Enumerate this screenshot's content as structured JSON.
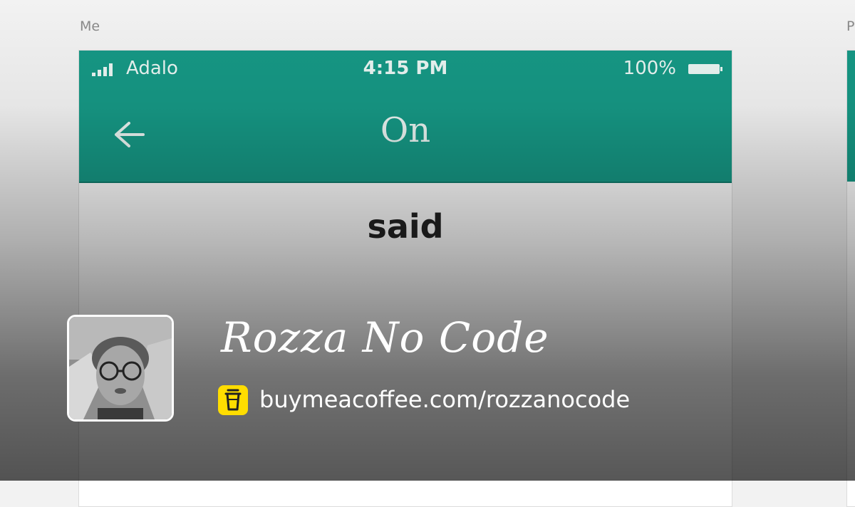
{
  "canvas": {
    "screen_label": "Me",
    "next_screen_label": "P"
  },
  "statusbar": {
    "carrier": "Adalo",
    "time": "4:15 PM",
    "battery": "100%"
  },
  "appbar": {
    "title": "On",
    "back_icon": "arrow-left-icon"
  },
  "content": {
    "text": "said"
  },
  "creator": {
    "name": "Rozza No Code",
    "link": "buymeacoffee.com/rozzanocode",
    "link_icon": "coffee-cup-icon"
  },
  "colors": {
    "app_bar": "#169885",
    "coffee_yellow": "#ffdd00",
    "overlay_text": "#ffffff"
  }
}
